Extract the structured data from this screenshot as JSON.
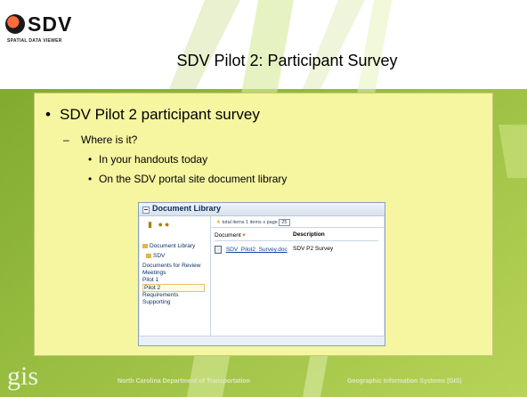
{
  "header": {
    "logo_text": "SDV",
    "logo_tagline": "SPATIAL DATA VIEWER",
    "title": "SDV Pilot 2: Participant Survey"
  },
  "content": {
    "bullet1": "SDV Pilot 2 participant survey",
    "bullet2": "Where is it?",
    "bullet3a": "In your handouts today",
    "bullet3b": "On the SDV portal site document library"
  },
  "screenshot": {
    "panel_title": "Document Library",
    "toolbar_text": "total items 1   items x page",
    "page_size": "25",
    "nav_items": [
      "Document Library",
      "SDV",
      "Documents for Review",
      "Meetings",
      "Pilot 1",
      "Pilot 2",
      "Requirements",
      "Supporting"
    ],
    "columns": [
      "Document",
      "Description"
    ],
    "rows": [
      {
        "document": "SDV_Pilot2_Survey.doc",
        "description": "SDV P2 Survey"
      }
    ]
  },
  "footer": {
    "logo": "gis",
    "left": "North Carolina Department of Transportation",
    "right": "Geographic Information Systems (GIS)"
  },
  "colors": {
    "background_green": "#9bbf3a",
    "content_yellow": "#f6f5a0"
  }
}
